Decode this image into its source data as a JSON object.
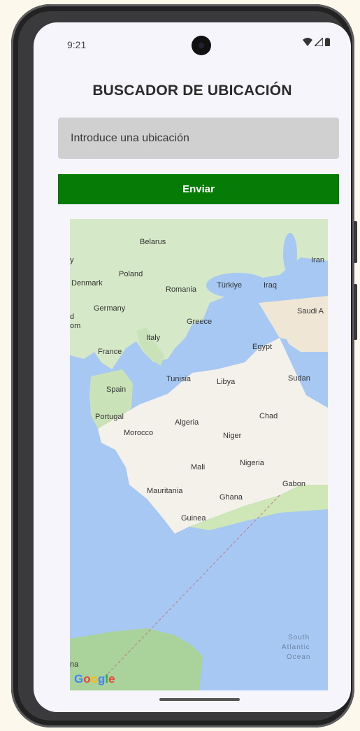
{
  "status_bar": {
    "time": "9:21"
  },
  "app": {
    "title": "BUSCADOR DE UBICACIÓN",
    "input_placeholder": "Introduce una ubicación",
    "input_value": "",
    "submit_label": "Enviar"
  },
  "map": {
    "attribution": "Google",
    "labels": {
      "belarus": "Belarus",
      "iran": "Iran",
      "poland": "Poland",
      "denmark": "Denmark",
      "romania": "Romania",
      "turkiye": "Türkiye",
      "iraq": "Iraq",
      "germany": "Germany",
      "saudi": "Saudi A",
      "greece": "Greece",
      "italy": "Italy",
      "france": "France",
      "egypt": "Egypt",
      "tunisia": "Tunisia",
      "libya": "Libya",
      "sudan": "Sudan",
      "spain": "Spain",
      "portugal": "Portugal",
      "algeria": "Algeria",
      "chad": "Chad",
      "morocco": "Morocco",
      "niger": "Niger",
      "nigeria": "Nigeria",
      "mali": "Mali",
      "gabon": "Gabon",
      "mauritania": "Mauritania",
      "ghana": "Ghana",
      "guinea": "Guinea",
      "south_atlantic_1": "South",
      "south_atlantic_2": "Atlantic",
      "south_atlantic_3": "Ocean",
      "partial_y": "y",
      "partial_d": "d",
      "partial_om": "om",
      "partial_na": "na"
    },
    "colors": {
      "water": "#a6c8f2",
      "land": "#d5e8c8",
      "desert": "#f4f1ea",
      "land_dark": "#a9d39a"
    }
  }
}
